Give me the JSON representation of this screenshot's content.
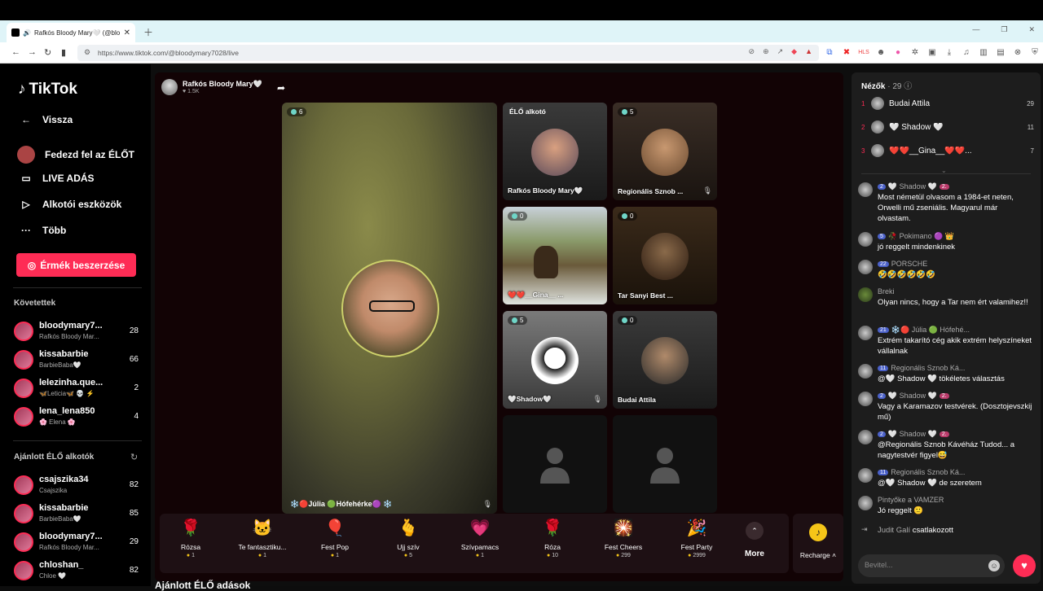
{
  "browser": {
    "tab_title": "Rafkós Bloody Mary🤍 (@blo",
    "url": "https://www.tiktok.com/@bloodymary7028/live"
  },
  "sidebar": {
    "logo": "TikTok",
    "back": "Vissza",
    "explore": "Fedezd fel az ÉLŐT",
    "live": "LIVE ADÁS",
    "creator_tools": "Alkotói eszközök",
    "more": "Több",
    "coins_button": "Érmék beszerzése",
    "following_header": "Követettek",
    "following": [
      {
        "name": "bloodymary7...",
        "sub": "Rafkós Bloody Mar...",
        "count": "28"
      },
      {
        "name": "kissabarbie",
        "sub": "BarbieBaba🤍",
        "count": "66"
      },
      {
        "name": "lelezinha.que...",
        "sub": "🦋Leticia🦋 💀 ⚡",
        "count": "2"
      },
      {
        "name": "lena_lena850",
        "sub": "🌸 Elena 🌸",
        "count": "4"
      }
    ],
    "recommended_header": "Ajánlott ÉLŐ alkotók",
    "recommended": [
      {
        "name": "csajszika34",
        "sub": "Csajszika",
        "count": "82"
      },
      {
        "name": "kissabarbie",
        "sub": "BarbieBaba🤍",
        "count": "85"
      },
      {
        "name": "bloodymary7...",
        "sub": "Rafkós Bloody Mar...",
        "count": "29"
      },
      {
        "name": "chloshan_",
        "sub": "Chloe 🤍",
        "count": "82"
      }
    ]
  },
  "stream": {
    "host_name": "Rafkós Bloody Mary🤍",
    "likes": "♥ 1.5K",
    "main_badge": "6",
    "main_name": "❄️🔴Júlia 🟢Hófehérke🟣 ❄️",
    "tiles": [
      {
        "label": "Rafkós Bloody Mary🤍",
        "top": "ÉLŐ alkotó",
        "badge": ""
      },
      {
        "label": "Regionális Sznob ...",
        "badge": "5"
      },
      {
        "label": "❤️❤️__Gina__ ...",
        "badge": "0"
      },
      {
        "label": "Tar Sanyi Best ...",
        "badge": "0"
      },
      {
        "label": "🤍Shadow🤍",
        "badge": "5"
      },
      {
        "label": "Budai Attila",
        "badge": "0"
      }
    ]
  },
  "gifts": [
    {
      "name": "Rózsa",
      "price": "1",
      "icon": "🌹"
    },
    {
      "name": "Te fantasztiku...",
      "price": "1",
      "icon": "🐱"
    },
    {
      "name": "Fest Pop",
      "price": "1",
      "icon": "🎈"
    },
    {
      "name": "Ujj szív",
      "price": "5",
      "icon": "🫰"
    },
    {
      "name": "Szívpamacs",
      "price": "1",
      "icon": "💗"
    },
    {
      "name": "Róza",
      "price": "10",
      "icon": "🌹"
    },
    {
      "name": "Fest Cheers",
      "price": "299",
      "icon": "🎇"
    },
    {
      "name": "Fest Party",
      "price": "2999",
      "icon": "🎉"
    }
  ],
  "more_label": "More",
  "recharge_label": "Recharge ˄",
  "bottom_label": "Ajánlott ÉLŐ adások",
  "chat": {
    "viewers_label": "Nézők",
    "viewers_count": "· 29",
    "viewers": [
      {
        "rank": "1",
        "name": "Budai Attila",
        "n": "29"
      },
      {
        "rank": "2",
        "name": "🤍 Shadow 🤍",
        "n": "11"
      },
      {
        "rank": "3",
        "name": "❤️❤️__Gina__❤️❤️...",
        "n": "7"
      }
    ],
    "messages": [
      {
        "lv": "2",
        "name": "🤍 Shadow 🤍",
        "pink": "2.",
        "text": "Most németül olvasom a 1984-et neten, Orwelli mű zseniális. Magyarul már olvastam."
      },
      {
        "lv": "5",
        "name": "🥀 Pokimano 🟣 👑",
        "pink": "",
        "text": "jó reggelt mindenkinek"
      },
      {
        "lv": "22",
        "name": "PORSCHE",
        "pink": "",
        "text": "🤣🤣🤣🤣🤣🤣"
      },
      {
        "lv": "",
        "name": "Breki",
        "pink": "",
        "text": "Olyan nincs, hogy a Tar nem ért valamihez!!"
      },
      {
        "lv": "21",
        "name": "❄️🔴 Júlia 🟢 Hófehé...",
        "pink": "",
        "text": "Extrém takarító cég akik extrém helyszíneket vállalnak"
      },
      {
        "lv": "11",
        "name": "Regionális Sznob Ká...",
        "pink": "",
        "text": "@🤍 Shadow 🤍 tökéletes választás"
      },
      {
        "lv": "2",
        "name": "🤍 Shadow 🤍",
        "pink": "2.",
        "text": "Vagy a Karamazov testvérek. (Dosztojevszkij mű)"
      },
      {
        "lv": "2",
        "name": "🤍 Shadow 🤍",
        "pink": "2.",
        "text": "@Regionális Sznob Kávéház Tudod... a nagytestvér figyel😅"
      },
      {
        "lv": "11",
        "name": "Regionális Sznob Ká...",
        "pink": "",
        "text": "@🤍 Shadow 🤍 de szeretem"
      },
      {
        "lv": "",
        "name": "Pintyőke a VAMZER",
        "pink": "",
        "text": "Jó reggelt 🙂"
      },
      {
        "lv": "",
        "name": "Judit Galí",
        "pink": "",
        "text": "csatlakozott"
      }
    ],
    "input_placeholder": "Bevitel..."
  }
}
